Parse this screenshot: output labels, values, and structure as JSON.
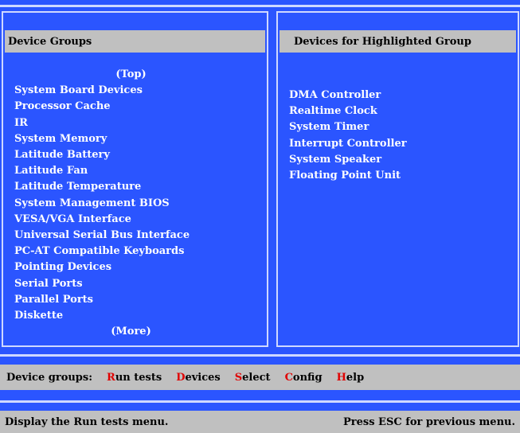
{
  "left_panel": {
    "header": "Device Groups",
    "top_marker": "(Top)",
    "items": [
      "System Board Devices",
      "Processor Cache",
      "IR",
      "System Memory",
      "Latitude Battery",
      "Latitude Fan",
      "Latitude Temperature",
      "System Management BIOS",
      "VESA/VGA Interface",
      "Universal Serial Bus Interface",
      "PC-AT Compatible Keyboards",
      "Pointing Devices",
      "Serial Ports",
      "Parallel Ports",
      "Diskette"
    ],
    "more_marker": "(More)"
  },
  "right_panel": {
    "header": "Devices for Highlighted Group",
    "items": [
      "DMA Controller",
      "Realtime Clock",
      "System Timer",
      "Interrupt Controller",
      "System Speaker",
      "Floating Point Unit"
    ]
  },
  "menu_bar": {
    "title": "Device groups:",
    "items": [
      {
        "hot": "R",
        "rest": "un tests"
      },
      {
        "hot": "D",
        "rest": "evices"
      },
      {
        "hot": "S",
        "rest": "elect"
      },
      {
        "hot": "C",
        "rest": "onfig"
      },
      {
        "hot": "H",
        "rest": "elp"
      }
    ]
  },
  "status_bar": {
    "left": "Display the Run tests menu.",
    "right": "Press ESC for previous menu."
  },
  "colors": {
    "background": "#2b55ff",
    "bar": "#c0c0c0",
    "hotkey": "#e00000"
  }
}
